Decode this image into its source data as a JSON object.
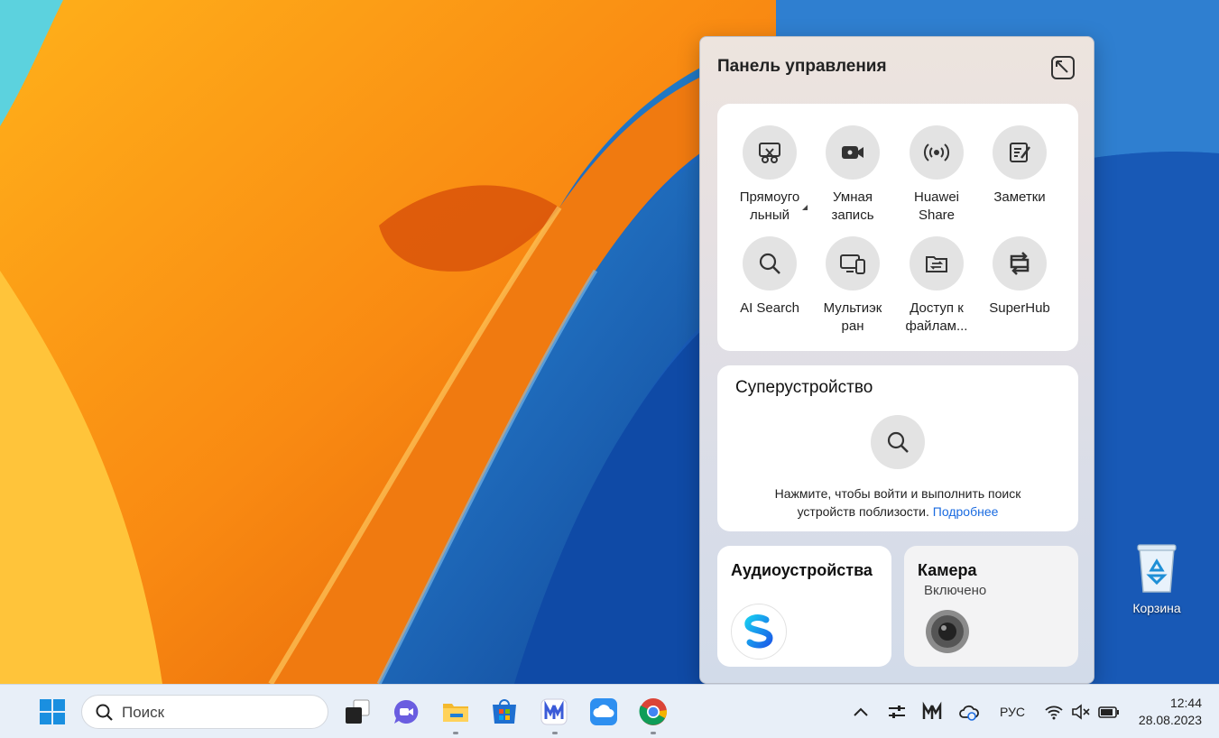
{
  "panel": {
    "title": "Панель управления",
    "tools": [
      {
        "label": "Прямоуго льный",
        "icon": "screenshot-scissors-icon"
      },
      {
        "label": "Умная запись",
        "icon": "video-camera-icon"
      },
      {
        "label": "Huawei Share",
        "icon": "wireless-broadcast-icon"
      },
      {
        "label": "Заметки",
        "icon": "notes-pen-icon"
      },
      {
        "label": "AI Search",
        "icon": "search-icon"
      },
      {
        "label": "Мультиэк ран",
        "icon": "multiscreen-icon"
      },
      {
        "label": "Доступ к файлам...",
        "icon": "folder-share-icon"
      },
      {
        "label": "SuperHub",
        "icon": "superhub-icon"
      }
    ],
    "super_device": {
      "title": "Суперустройство",
      "text_line1": "Нажмите, чтобы войти и выполнить поиск",
      "text_line2": "устройств поблизости.",
      "link": "Подробнее"
    },
    "audio": {
      "title": "Аудиоустройства"
    },
    "camera": {
      "title": "Камера",
      "status": "Включено"
    }
  },
  "desktop": {
    "recycle_bin_label": "Корзина"
  },
  "taskbar": {
    "search_placeholder": "Поиск",
    "language": "РУС",
    "time": "12:44",
    "date": "28.08.2023"
  },
  "colors": {
    "accent_link": "#1a6be0",
    "tool_circle": "#e3e3e3"
  }
}
